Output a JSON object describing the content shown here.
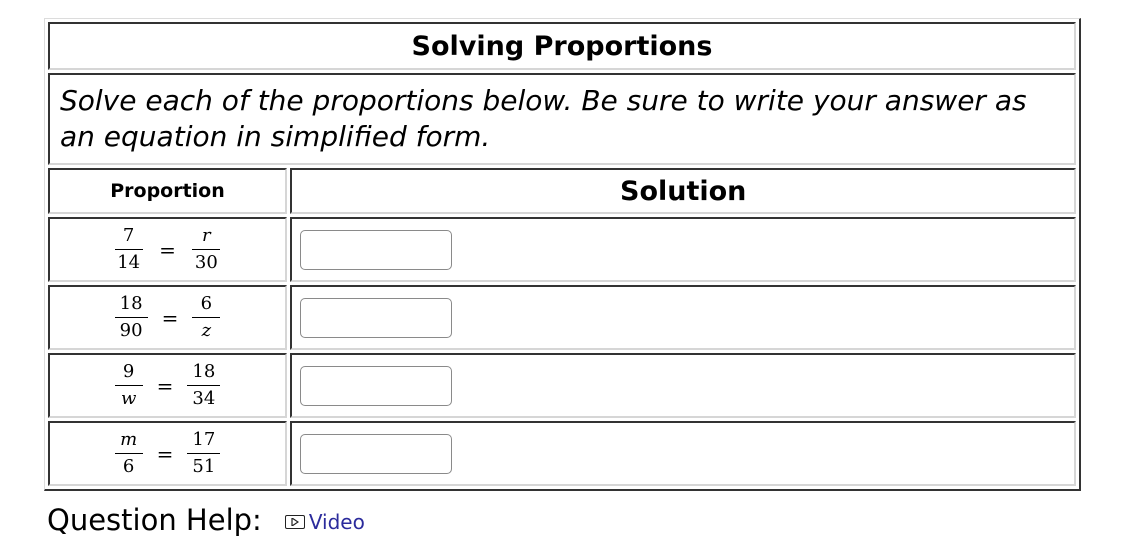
{
  "question": {
    "title": "Solving Proportions",
    "instructions": "Solve each of the proportions below. Be sure to write your answer as an equation in simplified form.",
    "headers": {
      "proportion": "Proportion",
      "solution": "Solution"
    },
    "rows": [
      {
        "left_num": "7",
        "left_den": "14",
        "right_num": "r",
        "right_den": "30",
        "answer": ""
      },
      {
        "left_num": "18",
        "left_den": "90",
        "right_num": "6",
        "right_den": "z",
        "answer": ""
      },
      {
        "left_num": "9",
        "left_den": "w",
        "right_num": "18",
        "right_den": "34",
        "answer": ""
      },
      {
        "left_num": "m",
        "left_den": "6",
        "right_num": "17",
        "right_den": "51",
        "answer": ""
      }
    ],
    "equals_sign": "="
  },
  "help": {
    "label": "Question Help:",
    "video_label": "Video",
    "video_icon": "play-video-icon",
    "link_color": "#2b2b9c"
  }
}
